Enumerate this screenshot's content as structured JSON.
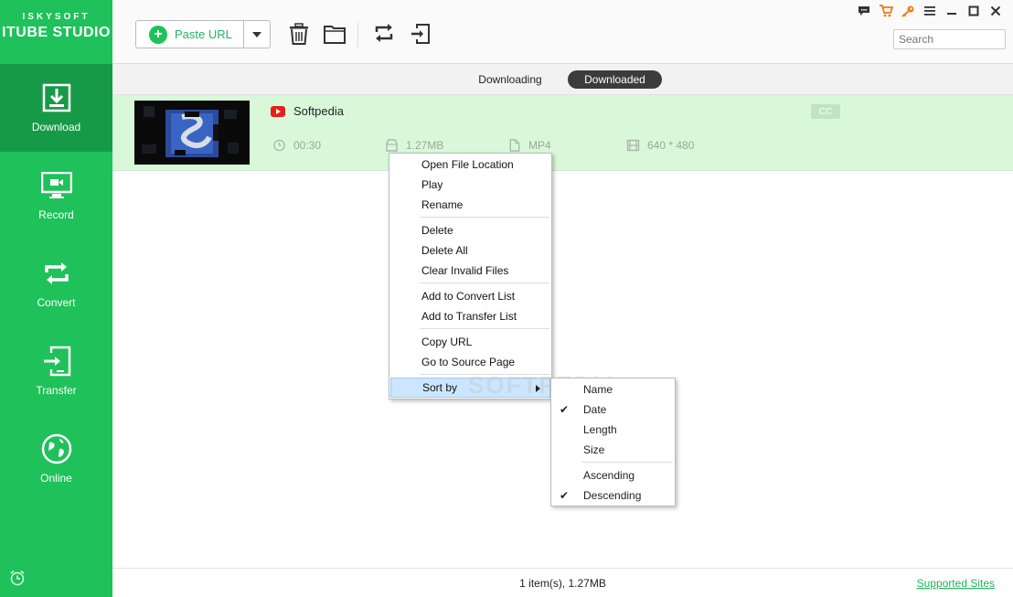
{
  "brand": {
    "top": "ISKYSOFT",
    "name": "ITUBE STUDIO"
  },
  "sidebar": {
    "items": [
      {
        "label": "Download",
        "icon": "download-icon",
        "active": true
      },
      {
        "label": "Record",
        "icon": "record-icon",
        "active": false
      },
      {
        "label": "Convert",
        "icon": "convert-icon",
        "active": false
      },
      {
        "label": "Transfer",
        "icon": "transfer-icon",
        "active": false
      },
      {
        "label": "Online",
        "icon": "globe-icon",
        "active": false
      }
    ]
  },
  "toolbar": {
    "paste_label": "Paste URL",
    "search_placeholder": "Search"
  },
  "tabs": {
    "downloading": "Downloading",
    "downloaded": "Downloaded",
    "active": "downloaded"
  },
  "item": {
    "title": "Softpedia",
    "duration": "00:30",
    "size": "1.27MB",
    "format": "MP4",
    "resolution": "640 * 480",
    "cc": "CC"
  },
  "context_menu": {
    "groups": [
      [
        "Open File Location",
        "Play",
        "Rename"
      ],
      [
        "Delete",
        "Delete All",
        "Clear Invalid Files"
      ],
      [
        "Add to Convert List",
        "Add to Transfer List"
      ],
      [
        "Copy URL",
        "Go to Source Page"
      ]
    ],
    "sort_label": "Sort by"
  },
  "sort_submenu": {
    "fields": [
      {
        "label": "Name",
        "checked": false
      },
      {
        "label": "Date",
        "checked": true
      },
      {
        "label": "Length",
        "checked": false
      },
      {
        "label": "Size",
        "checked": false
      }
    ],
    "orders": [
      {
        "label": "Ascending",
        "checked": false
      },
      {
        "label": "Descending",
        "checked": true
      }
    ]
  },
  "footer": {
    "status": "1 item(s), 1.27MB",
    "supported_sites": "Supported Sites"
  },
  "colors": {
    "accent": "#1fc15a",
    "active_nav": "#179a47",
    "row_bg": "#d9f8d9"
  },
  "watermark": "SOFTPEDIA"
}
